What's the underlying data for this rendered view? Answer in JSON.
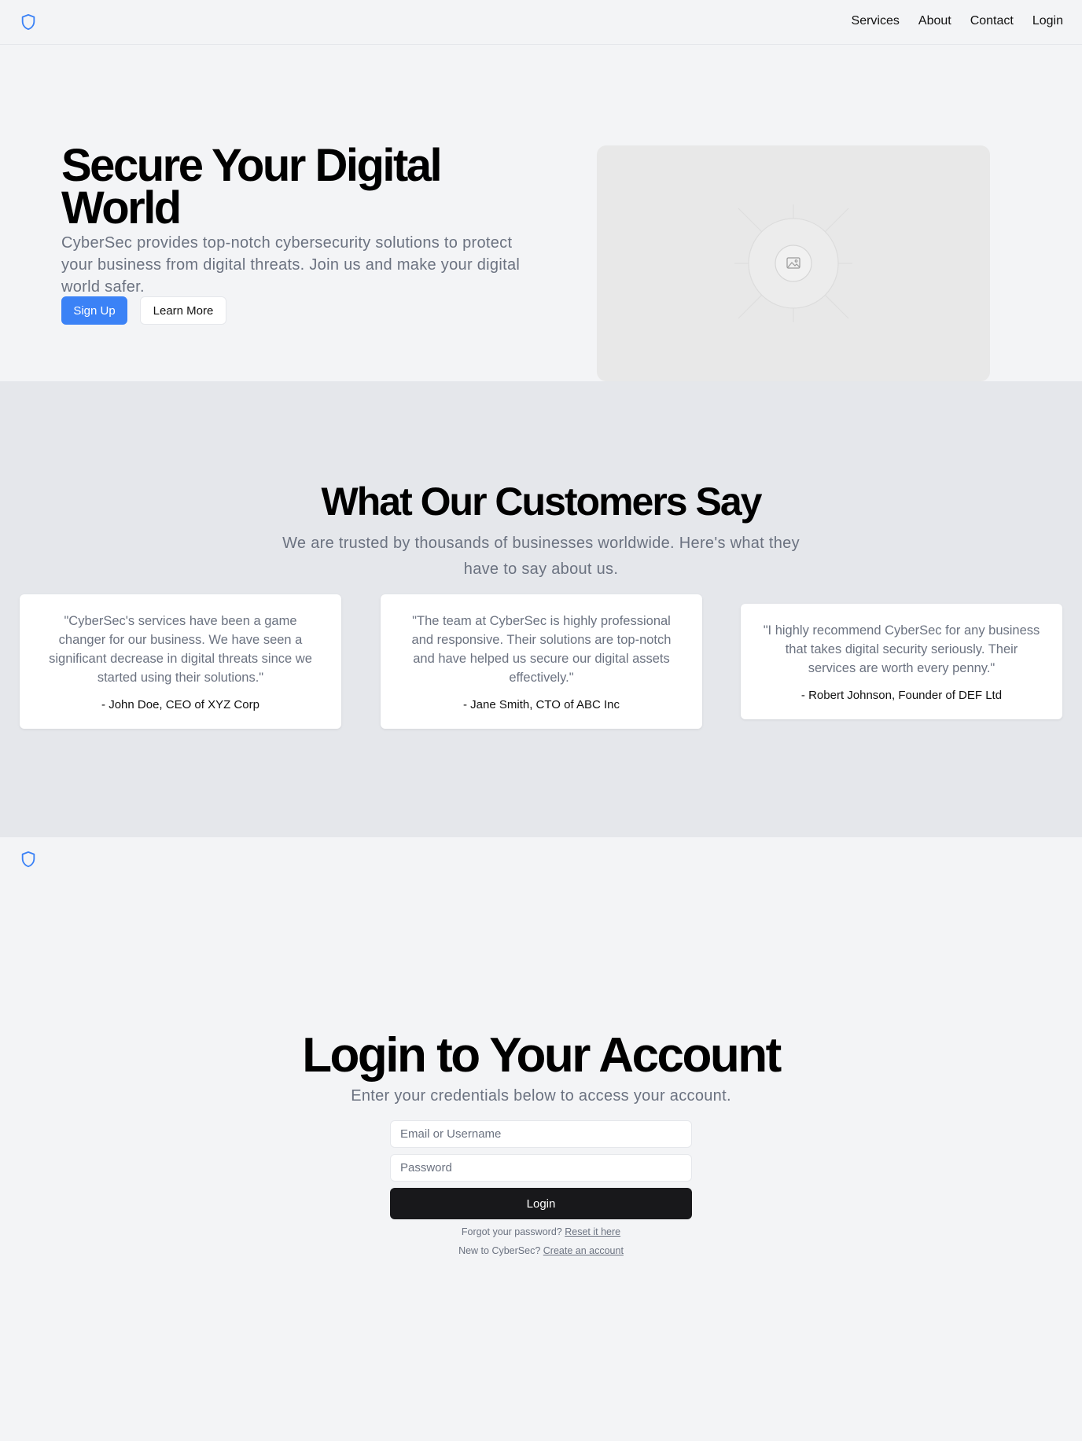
{
  "header": {
    "logo": "shield-icon",
    "nav": [
      "Services",
      "About",
      "Contact",
      "Login"
    ]
  },
  "hero": {
    "title": "Secure Your Digital World",
    "subtitle": "CyberSec provides top-notch cybersecurity solutions to protect your business from digital threats. Join us and make your digital world safer.",
    "primary_button": "Sign Up",
    "secondary_button": "Learn More",
    "image": "image-placeholder-icon"
  },
  "testimonials": {
    "title": "What Our Customers Say",
    "subtitle": "We are trusted by thousands of businesses worldwide. Here's what they have to say about us.",
    "items": [
      {
        "quote": "\"CyberSec's services have been a game changer for our business. We have seen a significant decrease in digital threats since we started using their solutions.\"",
        "author": "- John Doe, CEO of XYZ Corp"
      },
      {
        "quote": "\"The team at CyberSec is highly professional and responsive. Their solutions are top-notch and have helped us secure our digital assets effectively.\"",
        "author": "- Jane Smith, CTO of ABC Inc"
      },
      {
        "quote": "\"I highly recommend CyberSec for any business that takes digital security seriously. Their services are worth every penny.\"",
        "author": "- Robert Johnson, Founder of DEF Ltd"
      }
    ]
  },
  "login": {
    "title": "Login to Your Account",
    "subtitle": "Enter your credentials below to access your account.",
    "email_placeholder": "Email or Username",
    "password_placeholder": "Password",
    "button": "Login",
    "forgot_text": "Forgot your password?",
    "forgot_link": "Reset it here",
    "new_text": "New to CyberSec?",
    "new_link": "Create an account"
  },
  "colors": {
    "accent": "#3b82f6",
    "background": "#f3f4f6",
    "section_alt": "#e5e7eb",
    "muted_text": "#6b7280",
    "dark_button": "#18181b"
  }
}
